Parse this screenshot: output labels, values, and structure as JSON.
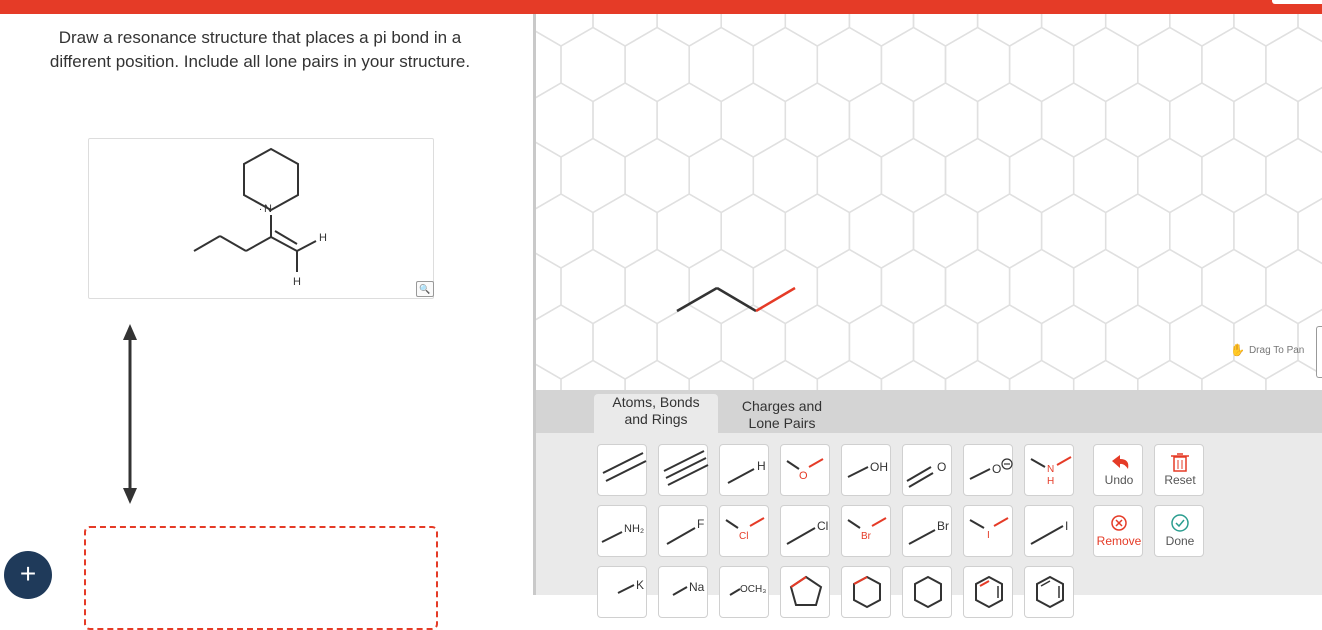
{
  "question": {
    "line1": "Draw a resonance structure that places a pi bond in a",
    "line2": "different position. Include all lone pairs in your structure."
  },
  "molecule": {
    "n_label": "N",
    "h_label_right": "H",
    "h_label_bottom": "H"
  },
  "canvas": {
    "drag_to_pan": "Drag To Pan"
  },
  "tabs": [
    {
      "line1": "Atoms, Bonds",
      "line2": "and Rings"
    },
    {
      "line1": "Charges and",
      "line2": "Lone Pairs"
    }
  ],
  "tools": {
    "hydrogen": "H",
    "oxygen": "O",
    "hydroxyl": "OH",
    "carbonyl_o": "O",
    "oxide": "O",
    "amine_n": "N",
    "amine_h": "H",
    "undo": "Undo",
    "reset": "Reset",
    "amino": "NH₂",
    "fluorine": "F",
    "chlorine_red": "Cl",
    "chlorine": "Cl",
    "bromine_red": "Br",
    "bromine": "Br",
    "iodine_red": "I",
    "iodine": "I",
    "remove": "Remove",
    "done": "Done",
    "potassium": "K",
    "sodium": "Na",
    "methoxy": "OCH₃"
  },
  "colors": {
    "accent": "#e53b27",
    "plus_button": "#1f3a5a",
    "grid": "#e0e0e0",
    "bond": "#333333"
  }
}
